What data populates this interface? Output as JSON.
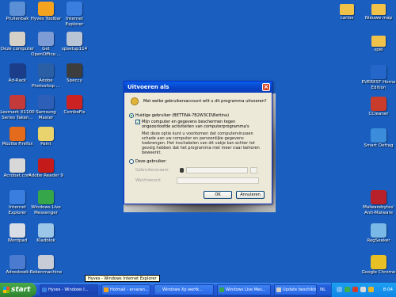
{
  "desktop": {
    "icons_left": [
      {
        "label": "Prullenbak",
        "icon": "recycle-bin-icon",
        "color": "#5b8fd6"
      },
      {
        "label": "Hyves Toolbar",
        "icon": "hyves-icon",
        "color": "#f3a31d"
      },
      {
        "label": "Internet Explorer",
        "icon": "internet-explorer-icon",
        "color": "#3a7ee0"
      },
      {
        "label": "Deze computer",
        "icon": "computer-icon",
        "color": "#d4d0c8"
      },
      {
        "label": "Get OpenOffice....",
        "icon": "openoffice-icon",
        "color": "#7d9cd6"
      },
      {
        "label": "spsetup114",
        "icon": "setup-icon",
        "color": "#b9c4d4"
      },
      {
        "label": "Ad-Rack",
        "icon": "adaware-icon",
        "color": "#1c3d8a"
      },
      {
        "label": "Adobe Photoshop ...",
        "icon": "photoshop-icon",
        "color": "#2a5fa6"
      },
      {
        "label": "Speccy",
        "icon": "speccy-icon",
        "color": "#3d3d3d"
      },
      {
        "label": "Lexmark X1100 Series Taken...",
        "icon": "printer-icon",
        "color": "#c43a3a"
      },
      {
        "label": "Samsung Master",
        "icon": "samsung-icon",
        "color": "#2d5fb8"
      },
      {
        "label": "ComboFix",
        "icon": "combofix-icon",
        "color": "#cc2222"
      },
      {
        "label": "Mozilla Firefox",
        "icon": "firefox-icon",
        "color": "#e36b1b"
      },
      {
        "label": "Paint",
        "icon": "paint-icon",
        "color": "#e9d36c"
      },
      {
        "label": "Acrobat.com",
        "icon": "acrobat-icon",
        "color": "#d8d8d8"
      },
      {
        "label": "Adobe Reader 9",
        "icon": "adobe-reader-icon",
        "color": "#c51a1a"
      },
      {
        "label": "Internet Explorer",
        "icon": "internet-explorer-icon",
        "color": "#3a7ee0"
      },
      {
        "label": "Windows Live Messenger",
        "icon": "messenger-icon",
        "color": "#36a64a"
      },
      {
        "label": "Wordpad",
        "icon": "wordpad-icon",
        "color": "#d8dde6"
      },
      {
        "label": "Kladblok",
        "icon": "notepad-icon",
        "color": "#9cc6e8"
      },
      {
        "label": "Adresboek",
        "icon": "addressbook-icon",
        "color": "#4a7bd0"
      },
      {
        "label": "Rekenmachine",
        "icon": "calculator-icon",
        "color": "#c8ccd6"
      }
    ],
    "icons_right": [
      {
        "label": "carlos",
        "icon": "folder-icon",
        "color": "#f1c24a"
      },
      {
        "label": "Nieuwe map",
        "icon": "folder-icon",
        "color": "#f1c24a"
      },
      {
        "label": "spel",
        "icon": "folder-icon",
        "color": "#f1c24a"
      },
      {
        "label": "EVEREST Home Edition",
        "icon": "everest-icon",
        "color": "#2466c9"
      },
      {
        "label": "CCleaner",
        "icon": "ccleaner-icon",
        "color": "#c93b2b"
      },
      {
        "label": "Smart Defrag",
        "icon": "defrag-icon",
        "color": "#3b8ddc"
      },
      {
        "label": "Malwarebytes' Anti-Malware",
        "icon": "malwarebytes-icon",
        "color": "#b8202a"
      },
      {
        "label": "RegSeeker",
        "icon": "regseeker-icon",
        "color": "#7ab8e8"
      },
      {
        "label": "Google Chrome",
        "icon": "chrome-icon",
        "color": "#e8c026"
      }
    ]
  },
  "dialog": {
    "title": "Uitvoeren als",
    "prompt": "Met welke gebruikersaccount wilt u dit programma uitvoeren?",
    "current_user_label": "Huidige gebruiker (BETTINA-7B2W3CD\\Bettina)",
    "protect_label": "Mijn computer en gegevens beschermen tegen ongeoorloofde activiteiten van computerprogramma's",
    "protect_note": "Met deze optie kunt u voorkomen dat computervirussen schade aan uw computer en persoonlijke gegevens toebrengen. Het inschakelen van dit vakje kan echter tot gevolg hebben dat het programma niet meer naar behoren beweerkt.",
    "other_user_label": "Deze gebruiker:",
    "username_label": "Gebruikersnaam:",
    "password_label": "Wachtwoord:",
    "ok_label": "OK",
    "cancel_label": "Annuleren"
  },
  "tooltip": "Hyves - Windows Internet Explorer",
  "taskbar": {
    "start_label": "start",
    "tasks": [
      {
        "label": "Hyves - Windows I...",
        "color": "#3a7ee0"
      },
      {
        "label": "Hotmail - ervaran...",
        "color": "#f3a31d"
      },
      {
        "label": "Windows Xp wertk...",
        "color": "#3a7ee0"
      },
      {
        "label": "Windows Live Mes...",
        "color": "#36a64a"
      },
      {
        "label": "Update beschikbaa...",
        "color": "#d4d0c8"
      }
    ],
    "language": "NL",
    "clock": "8:04"
  }
}
